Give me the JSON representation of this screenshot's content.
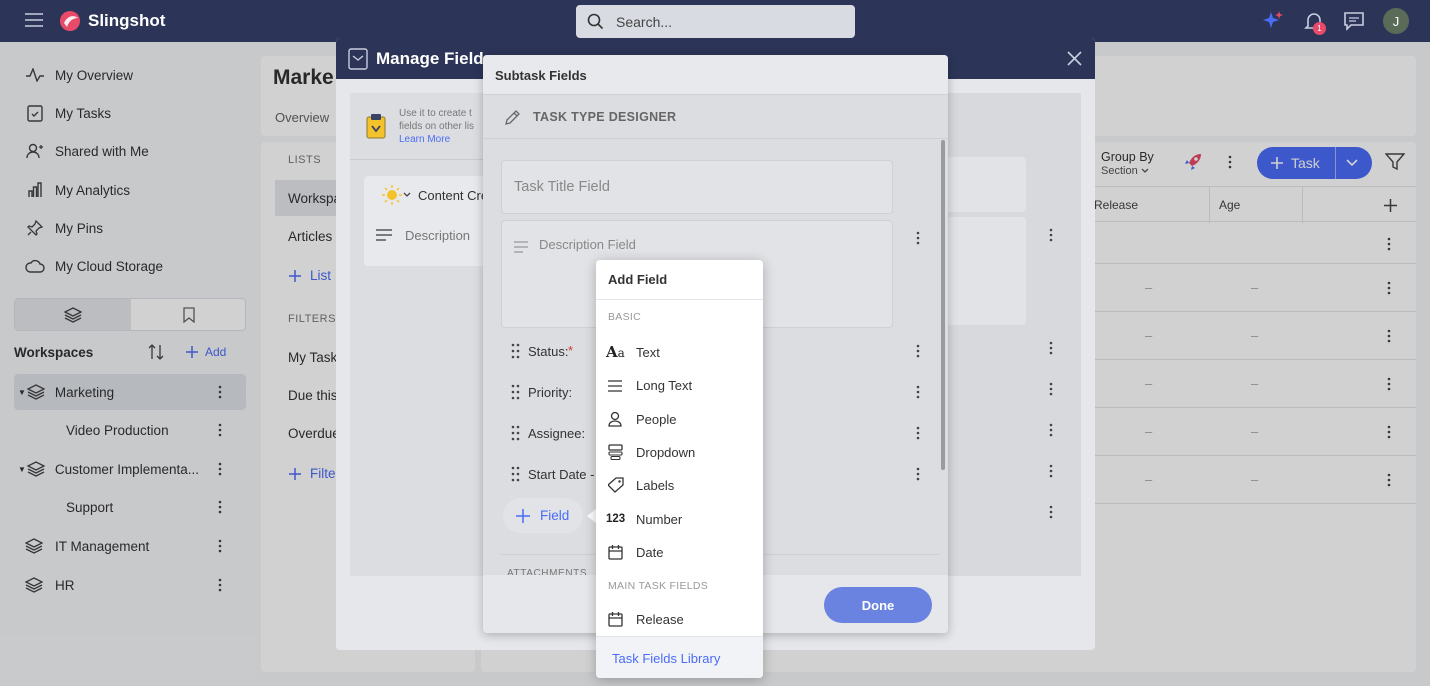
{
  "app": {
    "name": "Slingshot"
  },
  "header": {
    "search_placeholder": "Search...",
    "notification_count": "1",
    "user_initial": "J"
  },
  "sidebar": {
    "nav": [
      {
        "label": "My Overview"
      },
      {
        "label": "My Tasks"
      },
      {
        "label": "Shared with Me"
      },
      {
        "label": "My Analytics"
      },
      {
        "label": "My Pins"
      },
      {
        "label": "My Cloud Storage"
      }
    ],
    "workspaces_title": "Workspaces",
    "add_label": "Add",
    "workspaces": [
      {
        "label": "Marketing"
      },
      {
        "label": "Video Production"
      },
      {
        "label": "Customer Implementa..."
      },
      {
        "label": "Support"
      },
      {
        "label": "IT Management"
      },
      {
        "label": "HR"
      }
    ]
  },
  "workspace_page": {
    "title": "Marke",
    "tab_overview": "Overview",
    "lists_header": "LISTS",
    "lists": [
      "Workspa",
      "Articles"
    ],
    "add_list": "List",
    "filters_header": "FILTERS",
    "filters": [
      "My Task",
      "Due this",
      "Overdue"
    ],
    "add_filter": "Filte",
    "group_by": "Group By",
    "group_by_value": "Section",
    "task_button": "Task",
    "columns": [
      "Release",
      "Age"
    ],
    "dash": "–"
  },
  "manage_fields": {
    "title": "Manage Fields",
    "info_text_1": "Use it to create t",
    "info_text_2": "fields on other lis",
    "learn_more": "Learn More",
    "content_label": "Content Cre",
    "description_label": "Description"
  },
  "subtask_modal": {
    "title": "Subtask Fields",
    "designer_label": "TASK TYPE DESIGNER",
    "title_field_placeholder": "Task Title Field",
    "description_field_placeholder": "Description Field",
    "fields": [
      {
        "label": "Status:",
        "required": "*"
      },
      {
        "label": "Priority:",
        "required": ""
      },
      {
        "label": "Assignee:",
        "required": ""
      },
      {
        "label": "Start Date -",
        "required": ""
      }
    ],
    "add_field_button": "Field",
    "attachments_label": "ATTACHMENTS",
    "done_button": "Done"
  },
  "add_field_menu": {
    "title": "Add Field",
    "basic_header": "BASIC",
    "basic_items": [
      {
        "label": "Text",
        "icon": "text-icon"
      },
      {
        "label": "Long Text",
        "icon": "long-text-icon"
      },
      {
        "label": "People",
        "icon": "person-icon"
      },
      {
        "label": "Dropdown",
        "icon": "dropdown-icon"
      },
      {
        "label": "Labels",
        "icon": "tag-icon"
      },
      {
        "label": "Number",
        "icon": "number-icon",
        "glyph": "123"
      },
      {
        "label": "Date",
        "icon": "calendar-icon"
      }
    ],
    "main_header": "MAIN TASK FIELDS",
    "main_items": [
      {
        "label": "Release",
        "icon": "calendar-icon"
      }
    ],
    "library_link": "Task Fields Library"
  },
  "colors": {
    "topbar": "#2c3558",
    "accent": "#4a6cf7",
    "done": "#6a82e0",
    "selected": "#dfe2e8"
  }
}
